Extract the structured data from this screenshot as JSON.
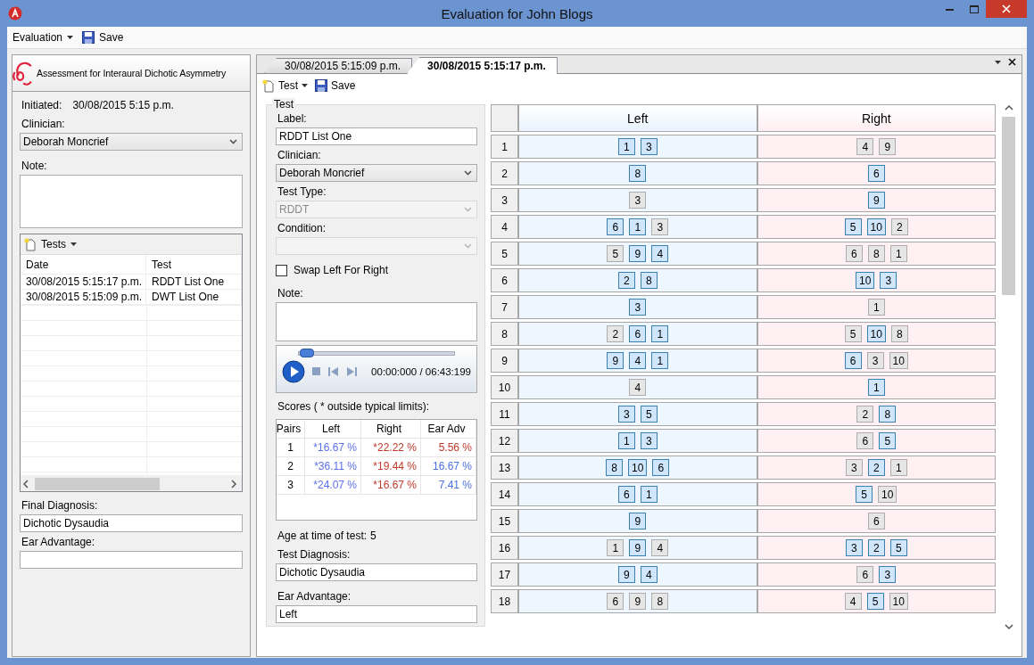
{
  "window": {
    "title": "Evaluation for John Blogs"
  },
  "menu": [
    {
      "label": "Evaluation",
      "kind": "dropdown"
    },
    {
      "label": "Save",
      "kind": "save"
    }
  ],
  "evaluation": {
    "title": "Assessment for Interaural Dichotic Asymmetry",
    "initiated_label": "Initiated:",
    "initiated": "30/08/2015 5:15 p.m.",
    "clinician_label": "Clinician:",
    "clinician": "Deborah Moncrief",
    "note_label": "Note:",
    "tests": {
      "toolbar": "Tests",
      "columns": [
        "Date",
        "Test"
      ],
      "rows": [
        [
          "30/08/2015 5:15:17 p.m.",
          "RDDT List One"
        ],
        [
          "30/08/2015 5:15:09 p.m.",
          "DWT List One"
        ]
      ]
    },
    "final_diagnosis_label": "Final Diagnosis:",
    "final_diagnosis": "Dichotic Dysaudia",
    "ear_advantage_label": "Ear Advantage:"
  },
  "tabs": [
    {
      "label": "30/08/2015 5:15:09 p.m.",
      "selected": false
    },
    {
      "label": "30/08/2015 5:15:17 p.m.",
      "selected": true
    }
  ],
  "toolbar": [
    {
      "label": "Test",
      "kind": "new"
    },
    {
      "label": "Save",
      "kind": "save"
    }
  ],
  "test": {
    "group": "Test",
    "label_label": "Label:",
    "label": "RDDT List One",
    "clinician_label": "Clinician:",
    "clinician": "Deborah Moncrief",
    "test_type_label": "Test Type:",
    "test_type": "RDDT",
    "test_type_disabled": true,
    "condition_label": "Condition:",
    "condition_disabled": true,
    "swap": {
      "label": "Swap Left For Right",
      "checked": false
    },
    "note_label": "Note:",
    "player": {
      "level": 0.02,
      "time": "00:00:000 / 06:43:199"
    },
    "scores_label": "Scores ( * outside typical limits):",
    "scores": {
      "columns": [
        "Pairs",
        "Left",
        "Right",
        "Ear Adv"
      ],
      "rows": [
        {
          "pairs": "1",
          "left": "*16.67 %",
          "right": "*22.22 %",
          "ear_adv": "5.56 %",
          "color": "#c0392b"
        },
        {
          "pairs": "2",
          "left": "*36.11 %",
          "right": "*19.44 %",
          "ear_adv": "16.67 %",
          "color": "#4a6fe0"
        },
        {
          "pairs": "3",
          "left": "*24.07 %",
          "right": "*16.67 %",
          "ear_adv": "7.41 %",
          "color": "#4a6fe0"
        }
      ]
    },
    "age_label": "Age at time of test:",
    "age": "5",
    "diagnosis_label": "Test Diagnosis:",
    "diagnosis": "Dichotic Dysaudia",
    "ear_advantage_label": "Ear Advantage:",
    "ear_advantage": "Left"
  },
  "grid": {
    "columns": [
      "Left",
      "Right"
    ],
    "rows": [
      {
        "number": "1",
        "left": [
          {
            "v": "1",
            "selected": true
          },
          {
            "v": "3",
            "selected": true
          }
        ],
        "right": [
          {
            "v": "4",
            "selected": false
          },
          {
            "v": "9",
            "selected": false
          }
        ]
      },
      {
        "number": "2",
        "left": [
          {
            "v": "8",
            "selected": true
          }
        ],
        "right": [
          {
            "v": "6",
            "selected": true
          }
        ]
      },
      {
        "number": "3",
        "left": [
          {
            "v": "3",
            "selected": false
          }
        ],
        "right": [
          {
            "v": "9",
            "selected": true
          }
        ]
      },
      {
        "number": "4",
        "left": [
          {
            "v": "6",
            "selected": true
          },
          {
            "v": "1",
            "selected": true
          },
          {
            "v": "3",
            "selected": false
          }
        ],
        "right": [
          {
            "v": "5",
            "selected": true
          },
          {
            "v": "10",
            "selected": true
          },
          {
            "v": "2",
            "selected": false
          }
        ]
      },
      {
        "number": "5",
        "left": [
          {
            "v": "5",
            "selected": false
          },
          {
            "v": "9",
            "selected": true
          },
          {
            "v": "4",
            "selected": true
          }
        ],
        "right": [
          {
            "v": "6",
            "selected": false
          },
          {
            "v": "8",
            "selected": false
          },
          {
            "v": "1",
            "selected": false
          }
        ]
      },
      {
        "number": "6",
        "left": [
          {
            "v": "2",
            "selected": true
          },
          {
            "v": "8",
            "selected": true
          }
        ],
        "right": [
          {
            "v": "10",
            "selected": true
          },
          {
            "v": "3",
            "selected": true
          }
        ]
      },
      {
        "number": "7",
        "left": [
          {
            "v": "3",
            "selected": true
          }
        ],
        "right": [
          {
            "v": "1",
            "selected": false
          }
        ]
      },
      {
        "number": "8",
        "left": [
          {
            "v": "2",
            "selected": false
          },
          {
            "v": "6",
            "selected": true
          },
          {
            "v": "1",
            "selected": true
          }
        ],
        "right": [
          {
            "v": "5",
            "selected": false
          },
          {
            "v": "10",
            "selected": true
          },
          {
            "v": "8",
            "selected": false
          }
        ]
      },
      {
        "number": "9",
        "left": [
          {
            "v": "9",
            "selected": true
          },
          {
            "v": "4",
            "selected": true
          },
          {
            "v": "1",
            "selected": true
          }
        ],
        "right": [
          {
            "v": "6",
            "selected": true
          },
          {
            "v": "3",
            "selected": false
          },
          {
            "v": "10",
            "selected": false
          }
        ]
      },
      {
        "number": "10",
        "left": [
          {
            "v": "4",
            "selected": false
          }
        ],
        "right": [
          {
            "v": "1",
            "selected": true
          }
        ]
      },
      {
        "number": "11",
        "left": [
          {
            "v": "3",
            "selected": true
          },
          {
            "v": "5",
            "selected": true
          }
        ],
        "right": [
          {
            "v": "2",
            "selected": false
          },
          {
            "v": "8",
            "selected": true
          }
        ]
      },
      {
        "number": "12",
        "left": [
          {
            "v": "1",
            "selected": true
          },
          {
            "v": "3",
            "selected": true
          }
        ],
        "right": [
          {
            "v": "6",
            "selected": false
          },
          {
            "v": "5",
            "selected": true
          }
        ]
      },
      {
        "number": "13",
        "left": [
          {
            "v": "8",
            "selected": true
          },
          {
            "v": "10",
            "selected": true
          },
          {
            "v": "6",
            "selected": true
          }
        ],
        "right": [
          {
            "v": "3",
            "selected": false
          },
          {
            "v": "2",
            "selected": true
          },
          {
            "v": "1",
            "selected": false
          }
        ]
      },
      {
        "number": "14",
        "left": [
          {
            "v": "6",
            "selected": true
          },
          {
            "v": "1",
            "selected": true
          }
        ],
        "right": [
          {
            "v": "5",
            "selected": true
          },
          {
            "v": "10",
            "selected": false
          }
        ]
      },
      {
        "number": "15",
        "left": [
          {
            "v": "9",
            "selected": true
          }
        ],
        "right": [
          {
            "v": "6",
            "selected": false
          }
        ]
      },
      {
        "number": "16",
        "left": [
          {
            "v": "1",
            "selected": false
          },
          {
            "v": "9",
            "selected": true
          },
          {
            "v": "4",
            "selected": false
          }
        ],
        "right": [
          {
            "v": "3",
            "selected": true
          },
          {
            "v": "2",
            "selected": true
          },
          {
            "v": "5",
            "selected": true
          }
        ]
      },
      {
        "number": "17",
        "left": [
          {
            "v": "9",
            "selected": true
          },
          {
            "v": "4",
            "selected": true
          }
        ],
        "right": [
          {
            "v": "6",
            "selected": false
          },
          {
            "v": "3",
            "selected": true
          }
        ]
      },
      {
        "number": "18",
        "left": [
          {
            "v": "6",
            "selected": false
          },
          {
            "v": "9",
            "selected": false
          },
          {
            "v": "8",
            "selected": false
          }
        ],
        "right": [
          {
            "v": "4",
            "selected": false
          },
          {
            "v": "5",
            "selected": true
          },
          {
            "v": "10",
            "selected": false
          }
        ]
      }
    ]
  }
}
